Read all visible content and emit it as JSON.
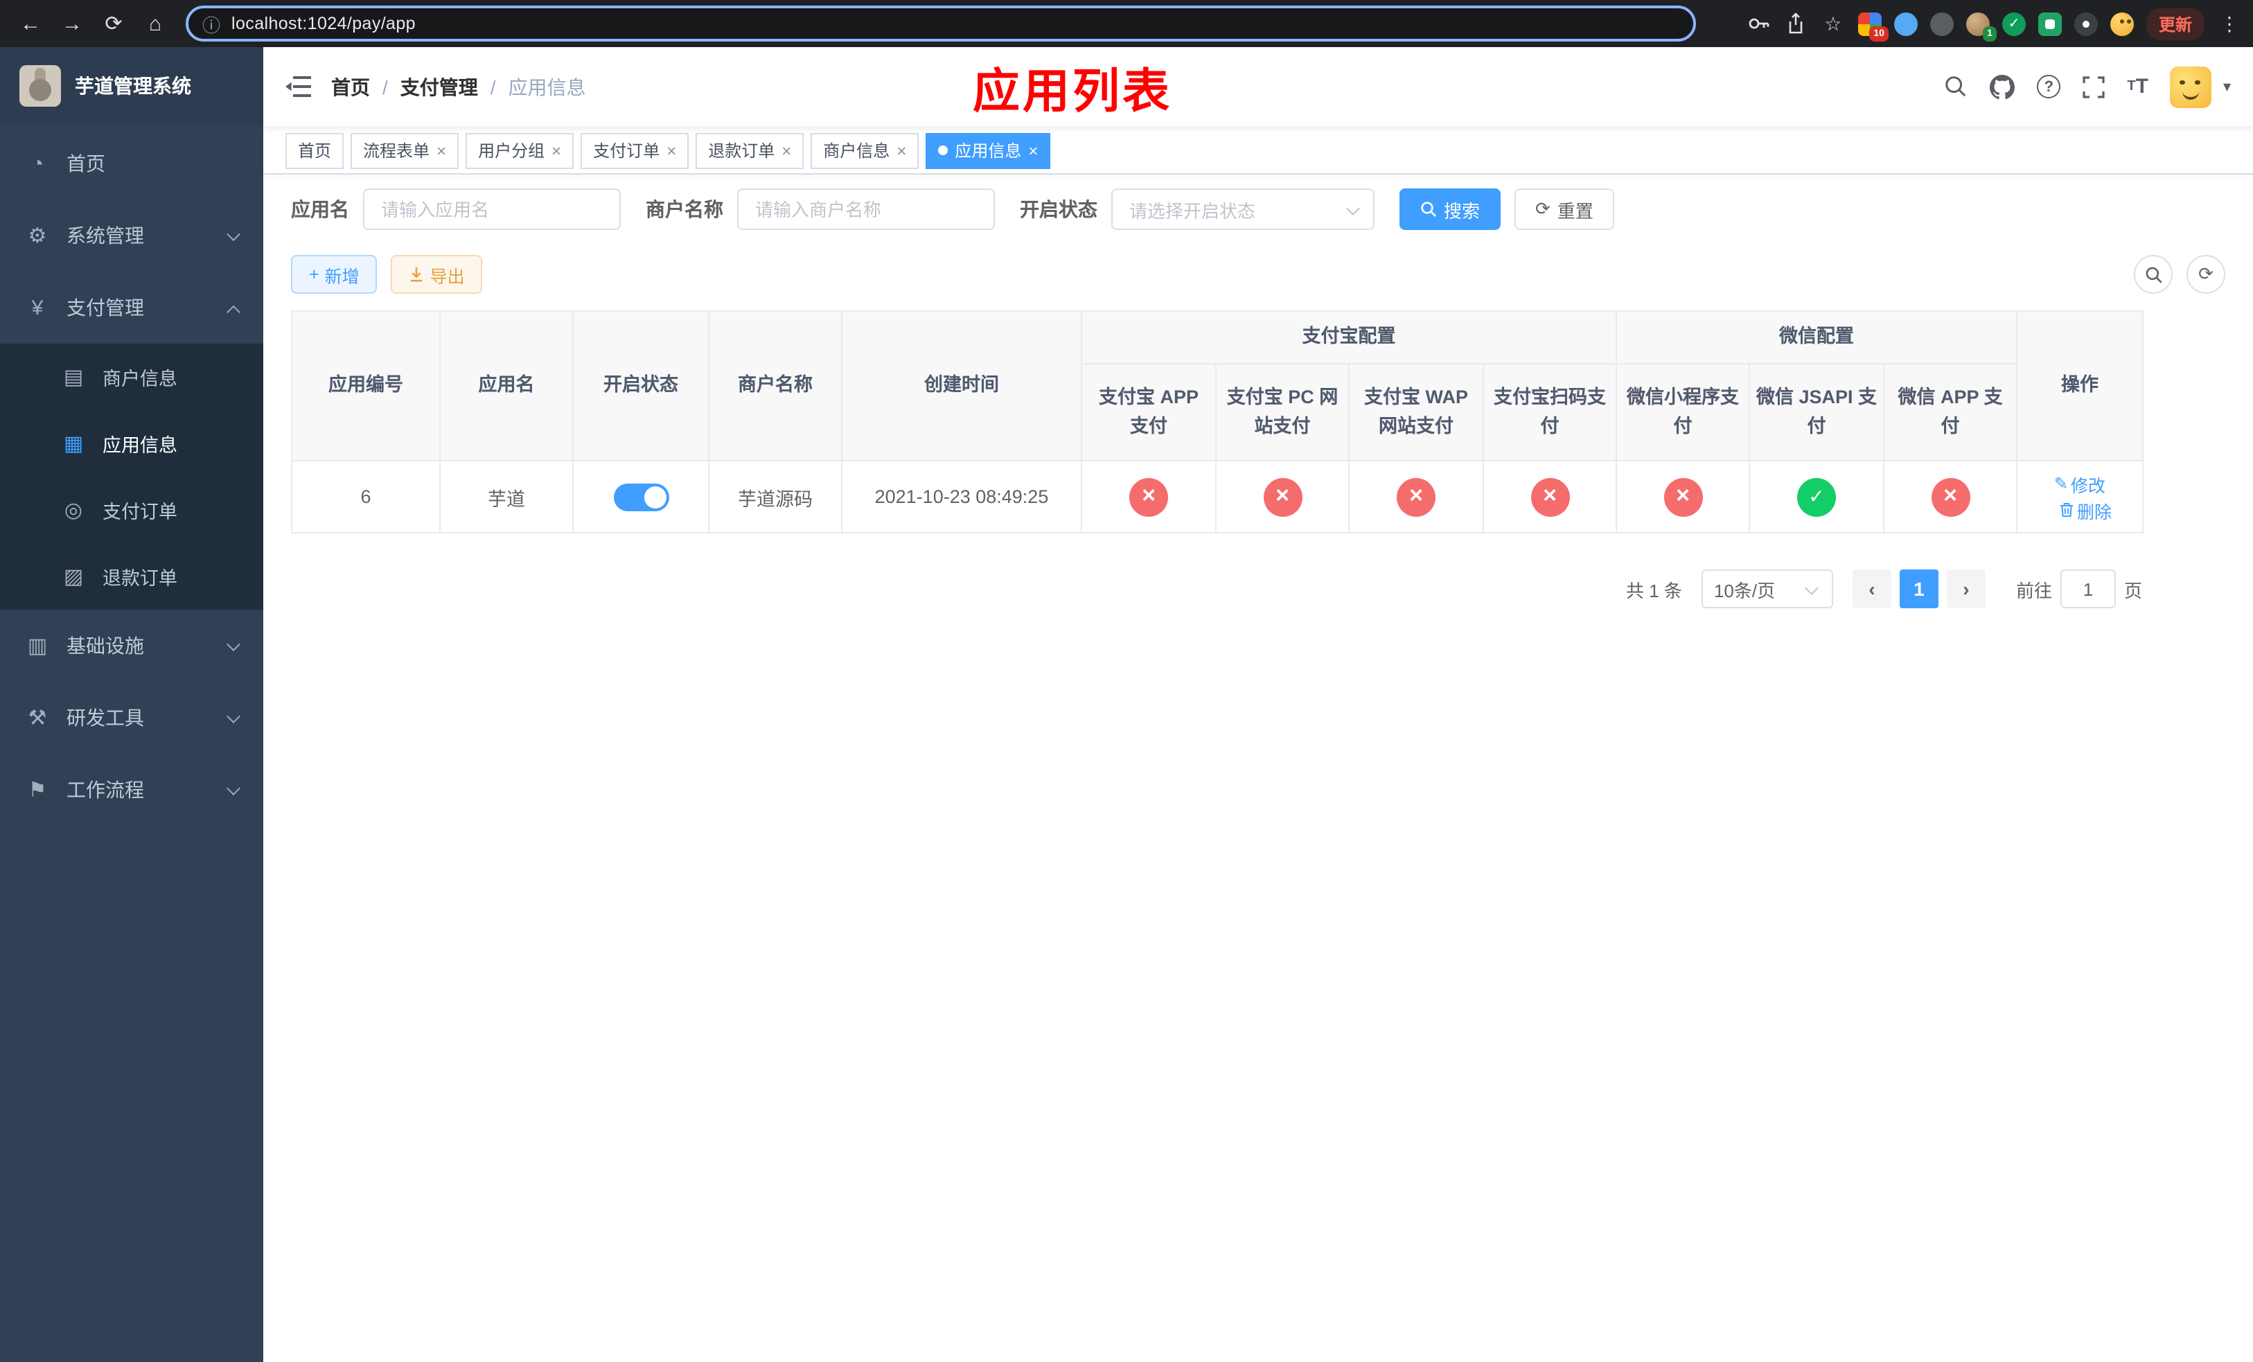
{
  "browser": {
    "url": "localhost:1024/pay/app",
    "update_label": "更新",
    "badge_extensions": "10",
    "badge_avatar": "1"
  },
  "icons": {
    "back": "←",
    "forward": "→",
    "reload": "⟳",
    "home": "⌂",
    "info": "ⓘ",
    "star": "☆",
    "more": "⋮",
    "caret": "▾",
    "close": "×",
    "plus": "+",
    "edit": "✎",
    "m_home": "◔",
    "m_gear": "⚙",
    "m_pay": "¥",
    "m_merchant": "▤",
    "m_app": "▦",
    "m_order": "◎",
    "m_refund": "▨",
    "m_infra": "▥",
    "m_tool": "⚒",
    "m_flow": "⚑"
  },
  "sidebar": {
    "title": "芋道管理系统",
    "menu": [
      {
        "label": "首页"
      },
      {
        "label": "系统管理"
      },
      {
        "label": "支付管理"
      },
      {
        "label": "基础设施"
      },
      {
        "label": "研发工具"
      },
      {
        "label": "工作流程"
      }
    ],
    "payment_children": [
      {
        "label": "商户信息"
      },
      {
        "label": "应用信息"
      },
      {
        "label": "支付订单"
      },
      {
        "label": "退款订单"
      }
    ]
  },
  "navbar": {
    "breadcrumb": [
      "首页",
      "支付管理",
      "应用信息"
    ],
    "annotation": "应用列表"
  },
  "tabs": [
    {
      "label": "首页"
    },
    {
      "label": "流程表单"
    },
    {
      "label": "用户分组"
    },
    {
      "label": "支付订单"
    },
    {
      "label": "退款订单"
    },
    {
      "label": "商户信息"
    },
    {
      "label": "应用信息"
    }
  ],
  "filters": {
    "app_name_label": "应用名",
    "app_name_placeholder": "请输入应用名",
    "merchant_label": "商户名称",
    "merchant_placeholder": "请输入商户名称",
    "status_label": "开启状态",
    "status_placeholder": "请选择开启状态",
    "search_button": "搜索",
    "reset_button": "重置"
  },
  "toolbar": {
    "add_button": "新增",
    "export_button": "导出"
  },
  "table": {
    "headers": {
      "app_id": "应用编号",
      "app_name": "应用名",
      "status": "开启状态",
      "merchant": "商户名称",
      "create_time": "创建时间",
      "alipay_group": "支付宝配置",
      "wechat_group": "微信配置",
      "alipay_app": "支付宝 APP 支付",
      "alipay_pc": "支付宝 PC 网站支付",
      "alipay_wap": "支付宝 WAP 网站支付",
      "alipay_qr": "支付宝扫码支付",
      "wx_mini": "微信小程序支付",
      "wx_jsapi": "微信 JSAPI 支付",
      "wx_app": "微信 APP 支付",
      "actions": "操作"
    },
    "rows": [
      {
        "id": "6",
        "name": "芋道",
        "status": "on",
        "merchant": "芋道源码",
        "created": "2021-10-23 08:49:25",
        "alipay_app": "no",
        "alipay_pc": "no",
        "alipay_wap": "no",
        "alipay_qr": "no",
        "wx_mini": "no",
        "wx_jsapi": "yes",
        "wx_app": "no",
        "edit": "修改",
        "remove": "删除"
      }
    ]
  },
  "pagination": {
    "total": "共 1 条",
    "page_size": "10条/页",
    "page": "1",
    "goto": "前往",
    "goto_value": "1",
    "unit": "页"
  }
}
